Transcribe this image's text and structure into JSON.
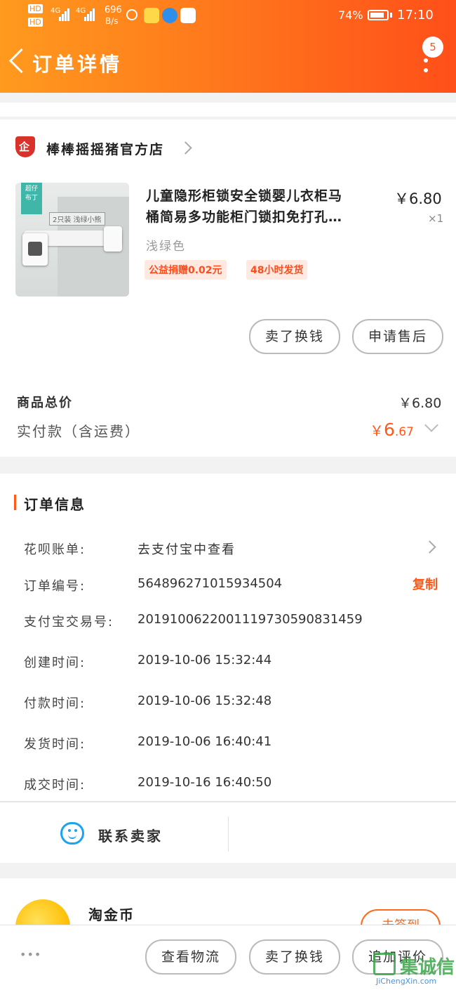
{
  "status_bar": {
    "hd1": "HD",
    "hd2": "HD",
    "net1": "4G",
    "net2": "4G",
    "speed_value": "696",
    "speed_unit": "B/s",
    "battery": "74%",
    "battery_level": 0.74,
    "time": "17:10"
  },
  "header": {
    "title": "订单详情",
    "message_count": "5"
  },
  "store": {
    "badge": "企",
    "name": "棒棒摇摇猪官方店"
  },
  "product": {
    "image_badge_line1": "超仔",
    "image_badge_line2": "布丁",
    "image_label": "2只装 浅绿小熊",
    "title_line1": "儿童隐形柜锁安全锁婴儿衣柜马",
    "title_line2": "桶简易多功能柜门锁扣免打孔…",
    "price": "￥6.80",
    "quantity": "×1",
    "variant": "浅绿色",
    "tags": [
      "公益捐赠0.02元",
      "48小时发货"
    ],
    "actions": [
      "卖了换钱",
      "申请售后"
    ]
  },
  "totals": {
    "goods_total_label": "商品总价",
    "goods_total_value": "￥6.80",
    "paid_label": "实付款（含运费）",
    "paid_symbol": "￥",
    "paid_integer": "6",
    "paid_decimal": ".67"
  },
  "order_info": {
    "section_title": "订单信息",
    "huabei_label": "花呗账单:",
    "huabei_value": "去支付宝中查看",
    "order_no_label": "订单编号:",
    "order_no_value": "564896271015934504",
    "copy_label": "复制",
    "alipay_label": "支付宝交易号:",
    "alipay_value": "2019100622001119730590831459",
    "created_label": "创建时间:",
    "created_value": "2019-10-06 15:32:44",
    "paid_time_label": "付款时间:",
    "paid_time_value": "2019-10-06 15:32:48",
    "shipped_label": "发货时间:",
    "shipped_value": "2019-10-06 16:40:41",
    "deal_label": "成交时间:",
    "deal_value": "2019-10-16 16:40:50"
  },
  "contact": {
    "label": "联系卖家"
  },
  "coins": {
    "title": "淘金币",
    "button_partial": "去签到"
  },
  "bottom_bar": {
    "more": "•••",
    "actions": [
      "查看物流",
      "卖了换钱",
      "追加评价"
    ]
  },
  "watermark": {
    "text": "集诚信",
    "domain": "JiChengXin.com"
  },
  "colors": {
    "brand_orange": "#ff6a1a",
    "price_orange": "#ff5a1a",
    "store_red": "#d9322a",
    "contact_blue": "#1aa3f0"
  }
}
